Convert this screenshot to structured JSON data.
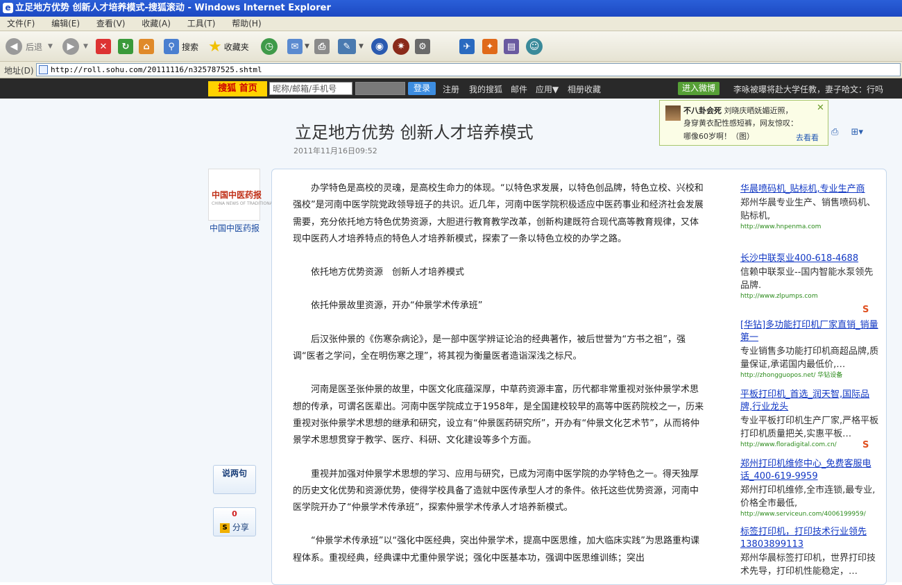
{
  "window": {
    "title": "立足地方优势 创新人才培养模式-搜狐滚动 - Windows Internet Explorer"
  },
  "menu": [
    "文件(F)",
    "编辑(E)",
    "查看(V)",
    "收藏(A)",
    "工具(T)",
    "帮助(H)"
  ],
  "toolbar": {
    "back": "后退",
    "search": "搜索",
    "favorites": "收藏夹"
  },
  "address": {
    "label": "地址(D)",
    "url": "http://roll.sohu.com/20111116/n325787525.shtml"
  },
  "sohu": {
    "logo": "搜狐 首页",
    "username_placeholder": "昵称/邮箱/手机号",
    "login": "登录",
    "links": [
      "注册",
      "我的搜狐",
      "邮件",
      "应用▼",
      "相册收藏"
    ],
    "weibo": "进入微博",
    "news": "李咏被曝将赴大学任教，妻子哈文：行吗"
  },
  "popup": {
    "source": "不八卦会死",
    "line1": "刘晓庆晒妩媚近照，",
    "line2": "身穿黄衣配性感短裤，网友惊叹：",
    "line3": "哪像60岁啊！（图）",
    "action": "去看看"
  },
  "article": {
    "title": "立足地方优势 创新人才培养模式",
    "date": "2011年11月16日09:52",
    "media_logo": "中国中医药报",
    "media_logo_sub": "CHINA NEWS OF TRADITIONAL CHINESE MEDICINE",
    "media_name": "中国中医药报",
    "comment_label": "说两句",
    "share_count": "0",
    "share_label": "分享",
    "paragraphs": [
      "办学特色是高校的灵魂，是高校生命力的体现。“以特色求发展，以特色创品牌，特色立校、兴校和强校”是河南中医学院党政领导班子的共识。近几年，河南中医学院积极适应中医药事业和经济社会发展需要，充分依托地方特色优势资源，大胆进行教育教学改革，创新构建既符合现代高等教育规律，又体现中医药人才培养特点的特色人才培养新模式，探索了一条以特色立校的办学之路。",
      "依托地方优势资源　创新人才培养模式",
      "依托仲景故里资源，开办“仲景学术传承班”",
      "后汉张仲景的《伤寒杂病论》，是一部中医学辨证论治的经典著作，被后世誉为“方书之祖”，强调“医者之学问，全在明伤寒之理”，将其视为衡量医者造诣深浅之标尺。",
      "河南是医圣张仲景的故里，中医文化底蕴深厚，中草药资源丰富，历代都非常重视对张仲景学术思想的传承，可谓名医辈出。河南中医学院成立于1958年，是全国建校较早的高等中医药院校之一，历来重视对张仲景学术思想的继承和研究，设立有“仲景医药研究所”，开办有“仲景文化艺术节”，从而将仲景学术思想贯穿于教学、医疗、科研、文化建设等多个方面。",
      "重视并加强对仲景学术思想的学习、应用与研究，已成为河南中医学院的办学特色之一。得天独厚的历史文化优势和资源优势，使得学校具备了造就中医传承型人才的条件。依托这些优势资源，河南中医学院开办了“仲景学术传承班”，探索仲景学术传承人才培养新模式。",
      "“仲景学术传承班”以“强化中医经典，突出仲景学术，提高中医思维，加大临床实践”为思路重构课程体系。重视经典，经典课中尤重仲景学说；强化中医基本功，强调中医思维训练；突出"
    ]
  },
  "ads": [
    {
      "title": "华晨喷码机_贴标机,专业生产商",
      "desc": "郑州华晨专业生产、销售喷码机、贴标机,",
      "url": "http://www.hnpenma.com"
    },
    {
      "title": "长沙中联泵业400-618-4688",
      "desc": "信赖中联泵业--国内智能水泵领先品牌.",
      "url": "http://www.zlpumps.com"
    },
    {
      "title": "[华钻]多功能打印机厂家直销_销量第一",
      "desc": "专业销售多功能打印机商超品牌,质量保证,承诺国内最低价,…",
      "url": "http://zhongguopos.net/ 华钻设备"
    },
    {
      "title": "平板打印机_首选_润天智,国际品牌,行业龙头",
      "desc": "专业平板打印机生产厂家,严格平板打印机质量把关,实惠平板…",
      "url": "http://www.floradigital.com.cn/"
    },
    {
      "title": "郑州打印机维修中心_免费客服电话_400-619-9959",
      "desc": "郑州打印机维修,全市连锁,最专业,价格全市最低,",
      "url": "http://www.serviceun.com/4006199959/"
    },
    {
      "title": "标签打印机，打印技术行业领先13803899113",
      "desc": "郑州华晨标签打印机，世界打印技术先导，打印机性能稳定，…",
      "url": ""
    }
  ],
  "sponsor_mark": "S"
}
